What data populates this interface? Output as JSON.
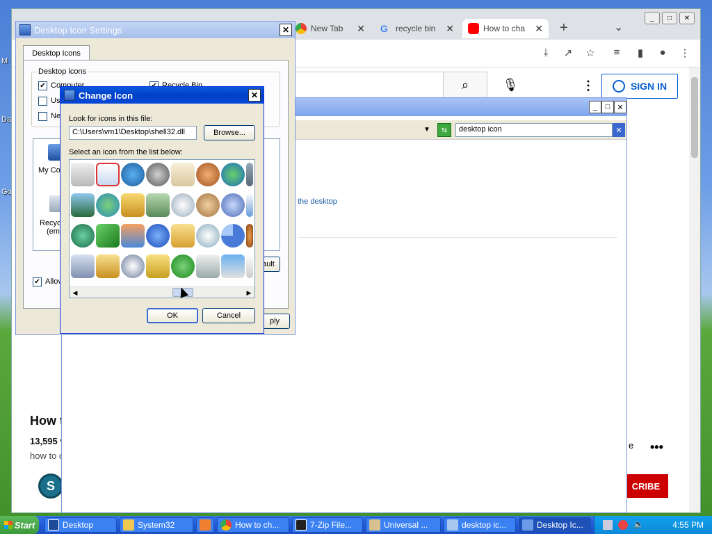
{
  "desktop": {
    "labels": [
      "M",
      "Da",
      "Go"
    ]
  },
  "chrome": {
    "tabs": [
      {
        "label": "New Tab"
      },
      {
        "label": "recycle bin"
      },
      {
        "label": "How to cha"
      }
    ],
    "new_tab": "+",
    "tab_menu": "⌄"
  },
  "youtube": {
    "sign_in": "SIGN IN",
    "video_title": "How to",
    "views": "13,595 vie",
    "desc": "how to cha",
    "channel_initial": "S",
    "subscribe": "CRIBE",
    "e_fragment": "e",
    "more": "•••"
  },
  "explorer": {
    "search_value": "desktop icon",
    "link_text": "the desktop"
  },
  "desktop_icon_settings": {
    "title": "Desktop Icon Settings",
    "tab": "Desktop Icons",
    "group_label": "Desktop icons",
    "checks": [
      {
        "label": "Computer",
        "checked": true
      },
      {
        "label": "Us",
        "checked": false
      },
      {
        "label": "Ne",
        "checked": false
      },
      {
        "label": "Recycle Bin",
        "checked": true
      }
    ],
    "icons": [
      "My Co",
      "Recyc",
      "(em"
    ],
    "allow_label": "Allov",
    "default_btn": "ault",
    "apply_btn": "ply"
  },
  "change_icon": {
    "title": "Change Icon",
    "look_label": "Look for icons in this file:",
    "path": "C:\\Users\\vm1\\Desktop\\shell32.dll",
    "browse": "Browse...",
    "select_label": "Select an icon from the list below:",
    "ok": "OK",
    "cancel": "Cancel"
  },
  "taskbar": {
    "start": "Start",
    "tasks": [
      {
        "label": "Desktop"
      },
      {
        "label": "System32"
      },
      {
        "label": ""
      },
      {
        "label": "How to ch..."
      },
      {
        "label": "7-Zip File..."
      },
      {
        "label": "Universal ..."
      },
      {
        "label": "desktop ic..."
      },
      {
        "label": "Desktop Ic..."
      }
    ],
    "clock": "4:55 PM"
  },
  "colors": {
    "xp_title_blue": "#0a5ae0",
    "yt_red": "#cc0000",
    "yt_blue": "#065fd4"
  }
}
